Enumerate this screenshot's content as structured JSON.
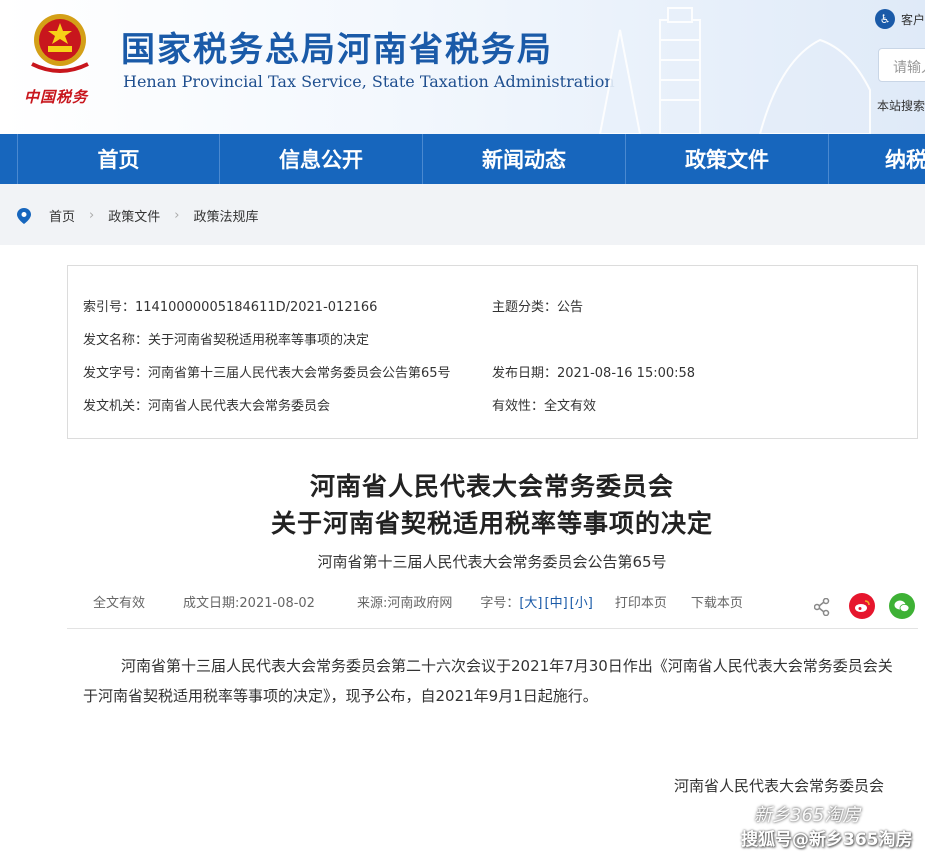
{
  "header": {
    "site_title": "国家税务总局河南省税务局",
    "site_subtitle": "Henan Provincial Tax Service, State Taxation Administration",
    "logo_text": "中国税务",
    "care_mode": "客户",
    "search_placeholder": "请输入",
    "site_map": "本站搜索"
  },
  "nav": {
    "items": [
      "首页",
      "信息公开",
      "新闻动态",
      "政策文件",
      "纳税"
    ]
  },
  "breadcrumb": {
    "items": [
      "首页",
      "政策文件",
      "政策法规库"
    ]
  },
  "meta": {
    "index_no": "索引号：11410000005184611D/2021-012166",
    "topic": "主题分类：公告",
    "doc_name": "发文名称：关于河南省契税适用税率等事项的决定",
    "doc_code": "发文字号：河南省第十三届人民代表大会常务委员会公告第65号",
    "publish_date": "发布日期：2021-08-16 15:00:58",
    "issuer": "发文机关：河南省人民代表大会常务委员会",
    "validity": "有效性：全文有效"
  },
  "article": {
    "title_line1": "河南省人民代表大会常务委员会",
    "title_line2": "关于河南省契税适用税率等事项的决定",
    "doc_number": "河南省第十三届人民代表大会常务委员会公告第65号",
    "body": "河南省第十三届人民代表大会常务委员会第二十六次会议于2021年7月30日作出《河南省人民代表大会常务委员会关于河南省契税适用税率等事项的决定》，现予公布，自2021年9月1日起施行。",
    "signer": "河南省人民代表大会常务委员会"
  },
  "toolbar": {
    "validity": "全文有效",
    "established": "成文日期:2021-08-02",
    "source": "来源:河南政府网",
    "font_label": "字号：",
    "font_large": "[大]",
    "font_medium": "[中]",
    "font_small": "[小]",
    "print": "打印本页",
    "download": "下载本页"
  },
  "watermark": {
    "line1": "新乡365淘房",
    "line2": "搜狐号@新乡365淘房"
  },
  "colors": {
    "brand_blue": "#1766bd",
    "title_blue": "#1a5aa8",
    "weibo_red": "#e6162d",
    "wechat_green": "#3eb135"
  }
}
